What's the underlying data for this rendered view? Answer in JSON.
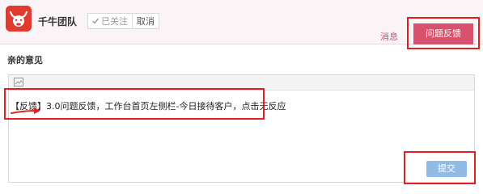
{
  "header": {
    "team_name": "千牛团队",
    "followed_label": "已关注",
    "cancel_label": "取消",
    "messages_label": "消息",
    "feedback_tab_label": "问题反馈"
  },
  "main": {
    "section_title": "亲的意见",
    "editor_text": "【反馈】3.0问题反馈，工作台首页左侧栏-今日接待客户，点击无反应",
    "submit_label": "提交"
  },
  "colors": {
    "brand_pink": "#d8516f",
    "logo_red": "#e23a2e",
    "annotation_red": "#e02020",
    "submit_blue": "#8fbbe4"
  },
  "icons": [
    "bull-logo-icon",
    "check-icon",
    "image-icon",
    "arrow-annotation-icon"
  ]
}
